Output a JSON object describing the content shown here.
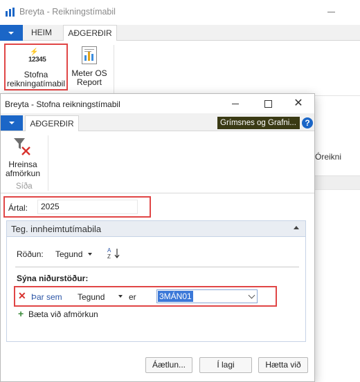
{
  "main": {
    "title": "Breyta - Reikningstímabil",
    "tabs": [
      "HEIM",
      "AÐGERÐIR"
    ],
    "ribbon": {
      "stofna_icon_text": "12345",
      "stofna_label_1": "Stofna",
      "stofna_label_2": "reikningatímabil",
      "meter_label_1": "Meter OS",
      "meter_label_2": "Report"
    },
    "column_header": "Óreikni"
  },
  "dialog": {
    "title": "Breyta - Stofna reikningstímabil",
    "tab": "AÐGERÐIR",
    "company": "Grímsnes og Grafni...",
    "help_glyph": "?",
    "close_glyph": "✕",
    "ribbon": {
      "clear_label_1": "Hreinsa",
      "clear_label_2": "afmörkun",
      "group": "Síða"
    },
    "year_label": "Ártal:",
    "year_value": "2025",
    "panel": {
      "title": "Teg. innheimtutímabila",
      "sort_label": "Röðun:",
      "sort_value": "Tegund",
      "results_heading": "Sýna niðurstöður:",
      "filter": {
        "connector": "Þar sem",
        "field": "Tegund",
        "operator": "er",
        "value": "3MÁN01"
      },
      "add_filter": "Bæta við afmörkun"
    },
    "buttons": {
      "plan": "Áætlun...",
      "ok": "Í lagi",
      "cancel": "Hætta við"
    }
  },
  "colors": {
    "accent_blue": "#1b66c7",
    "highlight_red": "#e04545",
    "company_badge": "#3a3a14",
    "selection": "#3b78d8"
  }
}
